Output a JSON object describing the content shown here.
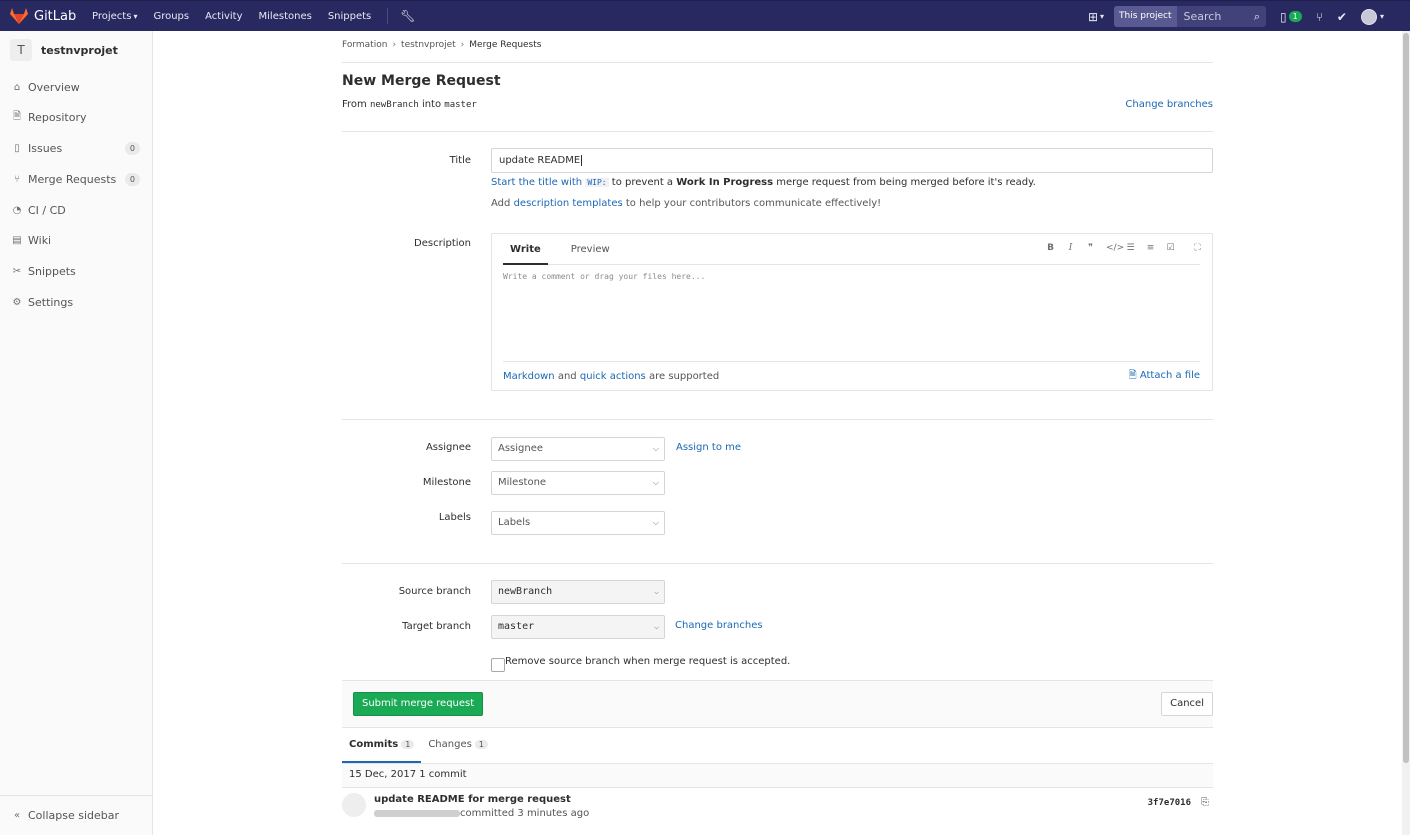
{
  "nav": {
    "brand": "GitLab",
    "links": [
      {
        "label": "Projects",
        "caret": "▾"
      },
      {
        "label": "Groups"
      },
      {
        "label": "Activity"
      },
      {
        "label": "Milestones"
      },
      {
        "label": "Snippets"
      }
    ],
    "search_scope": "This project",
    "search_placeholder": "Search",
    "todo_count": "1"
  },
  "sidebar": {
    "project_initial": "T",
    "project_name": "testnvprojet",
    "items": [
      {
        "label": "Overview",
        "icon": "home-icon"
      },
      {
        "label": "Repository",
        "icon": "file-icon"
      },
      {
        "label": "Issues",
        "icon": "issues-icon",
        "count": "0"
      },
      {
        "label": "Merge Requests",
        "icon": "merge-request-icon",
        "count": "0"
      },
      {
        "label": "CI / CD",
        "icon": "ci-cd-icon"
      },
      {
        "label": "Wiki",
        "icon": "book-icon"
      },
      {
        "label": "Snippets",
        "icon": "scissors-icon"
      },
      {
        "label": "Settings",
        "icon": "gear-icon"
      }
    ],
    "collapse_label": "Collapse sidebar"
  },
  "breadcrumb": {
    "items": [
      "Formation",
      "testnvprojet",
      "Merge Requests"
    ]
  },
  "page": {
    "title": "New Merge Request",
    "from_prefix": "From",
    "source_branch": "newBranch",
    "into": "into",
    "target_branch": "master",
    "change_branches": "Change branches"
  },
  "form": {
    "title_label": "Title",
    "title_value": "update README",
    "wip_hint_pre": "Start the title with",
    "wip_code": "WIP:",
    "wip_hint_mid": "to prevent a",
    "wip_hint_bold": "Work In Progress",
    "wip_hint_post": "merge request from being merged before it's ready.",
    "templates_pre": "Add",
    "templates_link": "description templates",
    "templates_post": "to help your contributors communicate effectively!",
    "description_label": "Description",
    "tab_write": "Write",
    "tab_preview": "Preview",
    "description_placeholder": "Write a comment or drag your files here...",
    "markdown_link": "Markdown",
    "and": "and",
    "quick_actions_link": "quick actions",
    "supported": "are supported",
    "attach_file": "Attach a file",
    "assignee_label": "Assignee",
    "assignee_value": "Assignee",
    "assign_to_me": "Assign to me",
    "milestone_label": "Milestone",
    "milestone_value": "Milestone",
    "labels_label": "Labels",
    "labels_value": "Labels",
    "source_branch_label": "Source branch",
    "source_branch_value": "newBranch",
    "target_branch_label": "Target branch",
    "target_branch_value": "master",
    "change_branches": "Change branches",
    "remove_source_label": "Remove source branch when merge request is accepted.",
    "submit": "Submit merge request",
    "cancel": "Cancel"
  },
  "commits": {
    "tab_commits": "Commits",
    "commits_count": "1",
    "tab_changes": "Changes",
    "changes_count": "1",
    "day_header": "15 Dec, 2017 1 commit",
    "items": [
      {
        "title": "update README for merge request",
        "meta": "committed 3 minutes ago",
        "sha": "3f7e7016"
      }
    ]
  },
  "colors": {
    "navbar": "#292961",
    "link": "#1b69b6",
    "submit": "#1aaa55"
  }
}
